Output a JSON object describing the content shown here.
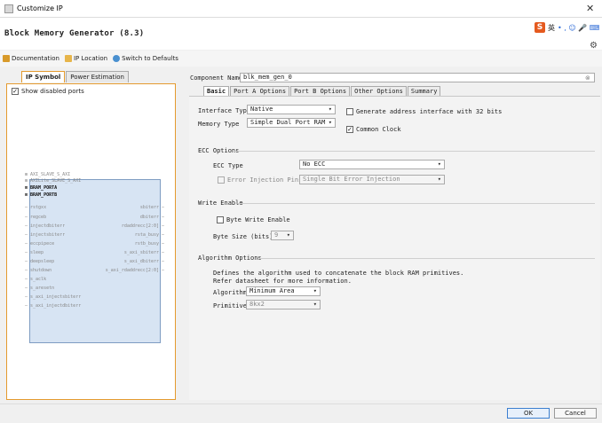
{
  "window": {
    "title": "Customize IP",
    "close_glyph": "✕"
  },
  "header": {
    "ip_name": "Block Memory Generator (8.3)",
    "ime_char": "英",
    "ime_marks": "• ,  ☺  🎤  ⌨"
  },
  "toolbar": {
    "documentation": "Documentation",
    "ip_location": "IP Location",
    "switch_defaults": "Switch to Defaults"
  },
  "left": {
    "tabs": [
      "IP Symbol",
      "Power Estimation"
    ],
    "show_disabled": "Show disabled ports",
    "left_pins": [
      "AXI_SLAVE_S_AXI",
      "AXILite_SLAVE_S_AXI",
      "BRAM_PORTA",
      "BRAM_PORTB",
      "rstgxx",
      "regceb",
      "injectdbiterr",
      "injectsbiterr",
      "eccpipece",
      "sleep",
      "deepsleep",
      "shutdown",
      "s_aclk",
      "s_aresetn",
      "s_axi_injectsbiterr",
      "s_axi_injectdbiterr"
    ],
    "right_pins": [
      "sbiterr",
      "dbiterr",
      "rdaddrecc[2:0]",
      "rsta_busy",
      "rstb_busy",
      "s_axi_sbiterr",
      "s_axi_dbiterr",
      "s_axi_rdaddrecc[2:0]"
    ]
  },
  "right": {
    "component_label": "Component Name",
    "component_value": "blk_mem_gen_0",
    "tabs": [
      "Basic",
      "Port A Options",
      "Port B Options",
      "Other Options",
      "Summary"
    ],
    "interface_label": "Interface Type",
    "interface_value": "Native",
    "memtype_label": "Memory Type",
    "memtype_value": "Simple Dual Port RAM",
    "gen_addr_label": "Generate address interface with 32 bits",
    "common_clock_label": "Common Clock",
    "ecc_section": "ECC Options",
    "ecc_type_label": "ECC Type",
    "ecc_type_value": "No ECC",
    "err_inj_label": "Error Injection Pins",
    "err_inj_value": "Single Bit Error Injection",
    "write_section": "Write Enable",
    "byte_write_label": "Byte Write Enable",
    "byte_size_label": "Byte Size (bits)",
    "byte_size_value": "9",
    "algo_section": "Algorithm Options",
    "algo_desc1": "Defines the algorithm used to concatenate the block RAM primitives.",
    "algo_desc2": "Refer datasheet for more information.",
    "algorithm_label": "Algorithm",
    "algorithm_value": "Minimum Area",
    "primitive_label": "Primitive",
    "primitive_value": "8kx2"
  },
  "footer": {
    "ok": "OK",
    "cancel": "Cancel"
  },
  "colors": {
    "accent": "#e49a2e",
    "symbol_fill": "#d7e4f3"
  }
}
